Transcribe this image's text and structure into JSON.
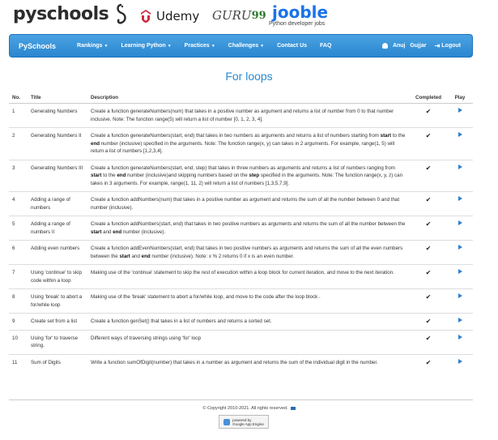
{
  "header": {
    "logo": "pyschools",
    "sponsors": {
      "udemy": "Udemy",
      "guru_text": "GURU",
      "guru_num": "99",
      "jooble": "jooble",
      "jooble_sub": "Python developer jobs"
    }
  },
  "nav": {
    "brand": "PySchools",
    "items": [
      "Rankings",
      "Learning Python",
      "Practices",
      "Challenges"
    ],
    "plain_items": [
      "Contact Us",
      "FAQ"
    ],
    "user": "Anuj   Gujjar",
    "logout": "Logout"
  },
  "page": {
    "title": "For loops"
  },
  "table": {
    "headers": {
      "no": "No.",
      "title": "Title",
      "description": "Description",
      "completed": "Completed",
      "play": "Play"
    },
    "rows": [
      {
        "no": "1",
        "title": "Generating Numbers",
        "description": "Create a function generateNumbers(num) that takes in a positive number as argument and returns a list of number from 0 to that number inclusive. Note: The function range(5) will return a list of number [0, 1, 2, 3, 4].",
        "completed": "✔"
      },
      {
        "no": "2",
        "title": "Generating Numbers II",
        "description": "Create a function generateNumbers(start, end) that takes in two numbers as arguments and returns a list of numbers starting from start to the end number (inclusive) specified in the arguments. Note: The function range(x, y) can takes in 2 arguments. For example, range(1, 5) will return a list of numbers [1,2,3,4].",
        "completed": "✔"
      },
      {
        "no": "3",
        "title": "Generating Numbers III",
        "description": "Create a function generateNumbers(start, end, step) that takes in three numbers as arguments and returns a list of numbers ranging from start to the end number (inclusive)and skipping numbers based on the step specified in the arguments. Note: The function range(x, y, z) can takes in 3 arguments. For example, range(1, 11, 2) will return a list of numbers [1,3,5,7,9].",
        "completed": "✔"
      },
      {
        "no": "4",
        "title": "Adding a range of numbers",
        "description": "Create a function addNumbers(num) that takes in a positive number as argument and returns the sum of all the number between 0 and that number (inclusive).",
        "completed": "✔"
      },
      {
        "no": "5",
        "title": "Adding a range of numbers II",
        "description": "Create a function addNumbers(start, end) that takes in two positive numbers as arguments and returns the sum of all the number between the start and end number (inclusive).",
        "completed": "✔"
      },
      {
        "no": "6",
        "title": "Adding even numbers",
        "description": "Create a function addEvenNumbers(start, end) that takes in two positive numbers as arguments and returns the sum of all the even numbers between the start and end number (inclusive). Note: x % 2 returns 0 if x is an even number.",
        "completed": "✔"
      },
      {
        "no": "7",
        "title": "Using 'continue' to skip code within a loop",
        "description": "Making use of the 'continue' statement to skip the rest of execution within a loop block for current iteration, and move to the next iteration.",
        "completed": "✔"
      },
      {
        "no": "8",
        "title": "Using 'break' to abort a for/while loop",
        "description": "Making use of the 'break' statement to abort a for/while loop, and move to the code after the loop block .",
        "completed": "✔"
      },
      {
        "no": "9",
        "title": "Create set from a list",
        "description": "Create a function genSet() that takes in a list of numbers and returns a sorted set.",
        "completed": "✔"
      },
      {
        "no": "10",
        "title": "Using 'for' to traverse string.",
        "description": "Different ways of traversing strings using 'for' loop",
        "completed": "✔"
      },
      {
        "no": "11",
        "title": "Sum of Digits",
        "description": "Write a function sumOfDigit(number) that takes in a number as argument and returns the sum of the individual digit in the number.",
        "completed": "✔"
      }
    ]
  },
  "footer": {
    "copyright": "© Copyright 2010-2021. All rights reserved.",
    "badge_top": "powered by",
    "badge_bottom": "Google App Engine"
  },
  "colors": {
    "nav": "#2b86cf",
    "title": "#2a8ad0",
    "play": "#2f7fd0"
  }
}
